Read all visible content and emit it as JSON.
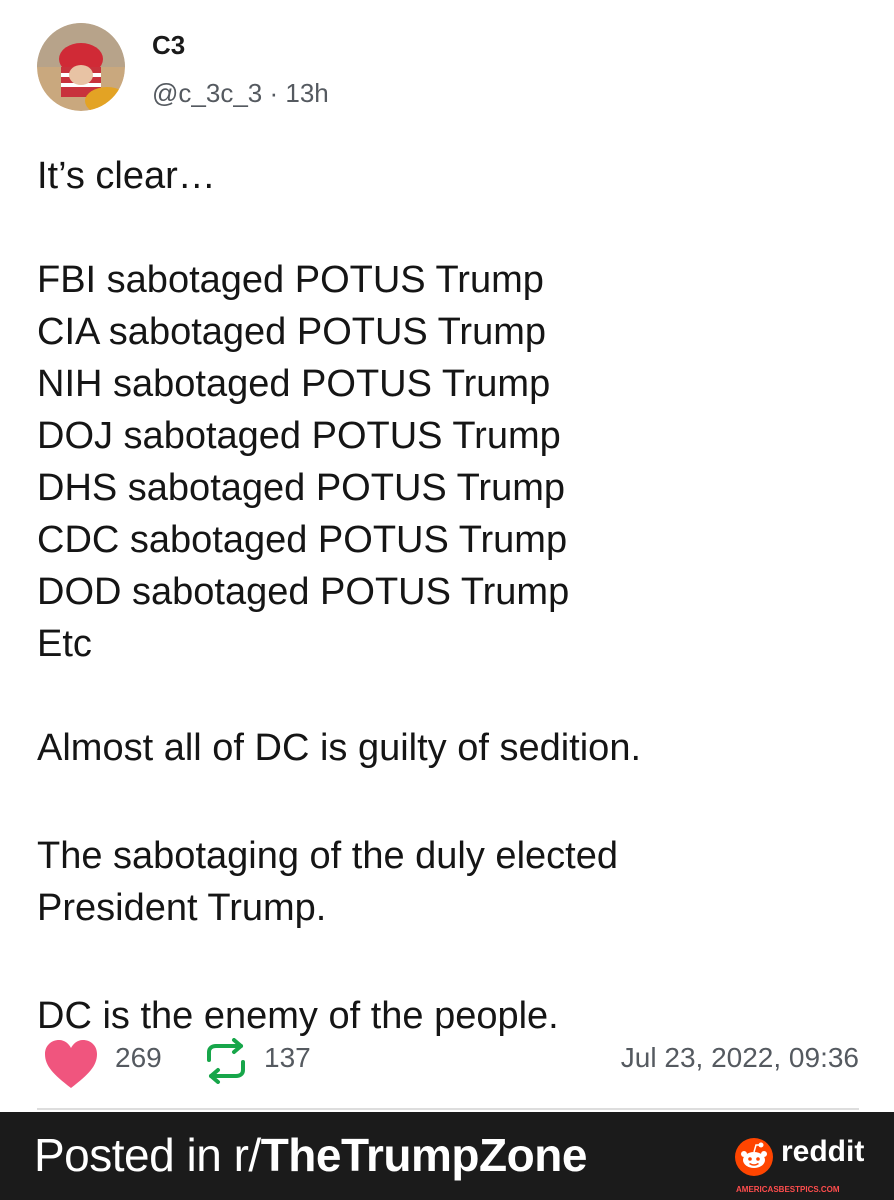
{
  "post": {
    "author_name": "C3",
    "handle": "@c_3c_3",
    "separator": "·",
    "age": "13h",
    "lines_intro": "It’s clear…",
    "list_lines": [
      "FBI sabotaged POTUS Trump",
      "CIA sabotaged POTUS Trump",
      "NIH sabotaged POTUS Trump",
      "DOJ sabotaged POTUS Trump",
      "DHS sabotaged POTUS Trump",
      "CDC sabotaged POTUS Trump",
      "DOD sabotaged POTUS Trump",
      "Etc"
    ],
    "paragraph_1": "Almost all of DC is guilty of sedition.",
    "paragraph_2_line_1": "The sabotaging of the duly elected",
    "paragraph_2_line_2": "President Trump.",
    "paragraph_3": "DC is the enemy of the people."
  },
  "stats": {
    "likes": "269",
    "reposts": "137",
    "date": "Jul 23, 2022, 09:36",
    "heart_color": "#f0557e"
  },
  "footer": {
    "posted_prefix": "Posted in r/",
    "subreddit": "TheTrumpZone",
    "brand": "reddit",
    "brand_color": "#ff4500",
    "watermark": "AMERICASBESTPICS.COM"
  },
  "icons": {
    "avatar": "avatar-photo",
    "like": "heart-icon",
    "repost": "repost-icon",
    "brand": "reddit-logo-icon"
  }
}
